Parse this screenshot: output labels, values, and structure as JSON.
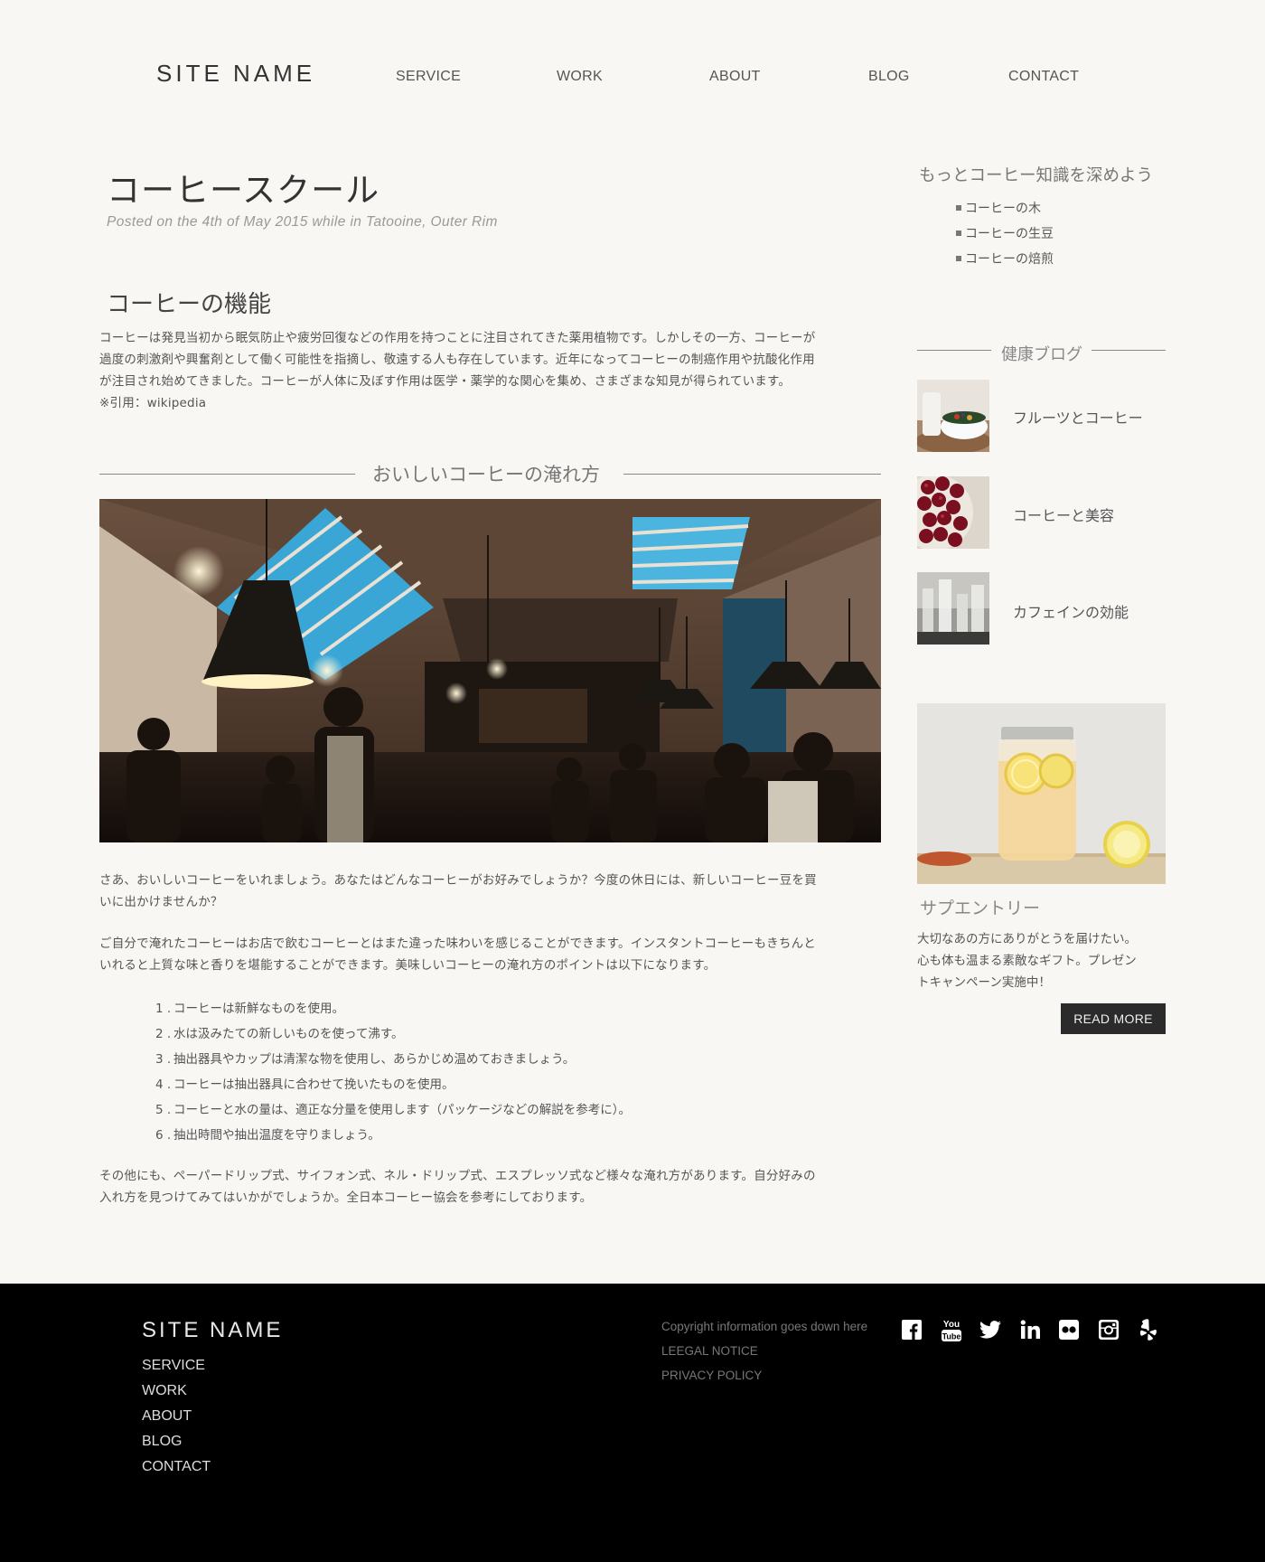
{
  "header": {
    "site_name": "SITE NAME",
    "nav": [
      "SERVICE",
      "WORK",
      "ABOUT",
      "BLOG",
      "CONTACT"
    ]
  },
  "article": {
    "title": "コーヒースクール",
    "posted": "Posted on the 4th of May 2015 while in Tatooine, Outer Rim",
    "section_title": "コーヒーの機能",
    "intro_lines": [
      "コーヒーは発見当初から眠気防止や疲労回復などの作用を持つことに注目されてきた薬用植物です。しかしその一方、コーヒーが",
      "過度の刺激剤や興奮剤として働く可能性を指摘し、敬遠する人も存在しています。近年になってコーヒーの制癌作用や抗酸化作用",
      "が注目され始めてきました。コーヒーが人体に及ぼす作用は医学・薬学的な関心を集め、さまざまな知見が得られています。",
      "※引用：wikipedia"
    ],
    "divider_title": "おいしいコーヒーの淹れ方",
    "para1_lines": [
      "さあ、おいしいコーヒーをいれましょう。あなたはどんなコーヒーがお好みでしょうか？今度の休日には、新しいコーヒー豆を買",
      "いに出かけませんか？"
    ],
    "para2_lines": [
      "ご自分で淹れたコーヒーはお店で飲むコーヒーとはまた違った味わいを感じることができます。インスタントコーヒーもきちんと",
      "いれると上質な味と香りを堪能することができます。美味しいコーヒーの淹れ方のポイントは以下になります。"
    ],
    "steps": [
      {
        "num": "1 .",
        "text": "コーヒーは新鮮なものを使用。"
      },
      {
        "num": "2 .",
        "text": "水は汲みたての新しいものを使って沸す。"
      },
      {
        "num": "3 .",
        "text": "抽出器具やカップは清潔な物を使用し、あらかじめ温めておきましょう。"
      },
      {
        "num": "4 .",
        "text": "コーヒーは抽出器具に合わせて挽いたものを使用。"
      },
      {
        "num": "5 .",
        "text": "コーヒーと水の量は、適正な分量を使用します（パッケージなどの解説を参考に）。"
      },
      {
        "num": "6 .",
        "text": "抽出時間や抽出温度を守りましょう。"
      }
    ],
    "para3_lines": [
      "その他にも、ペーパードリップ式、サイフォン式、ネル・ドリップ式、エスプレッソ式など様々な淹れ方があります。自分好みの",
      "入れ方を見つけてみてはいかがでしょうか。全日本コーヒー協会を参考にしております。"
    ]
  },
  "sidebar": {
    "heading": "もっとコーヒー知識を深めよう",
    "links": [
      "コーヒーの木",
      "コーヒーの生豆",
      "コーヒーの焙煎"
    ],
    "blog_heading": "健康ブログ",
    "blog_items": [
      "フルーツとコーヒー",
      "コーヒーと美容",
      "カフェインの効能"
    ],
    "promo_title": "サプエントリー",
    "promo_lines": [
      "大切なあの方にありがとうを届けたい。",
      "心も体も温まる素敵なギフト。プレゼン",
      "トキャンペーン実施中！"
    ],
    "read_more": "READ MORE"
  },
  "footer": {
    "site_name": "SITE NAME",
    "nav": [
      "SERVICE",
      "WORK",
      "ABOUT",
      "BLOG",
      "CONTACT"
    ],
    "copyright": "Copyright information goes down here",
    "legal": "LEEGAL NOTICE",
    "privacy": "PRIVACY POLICY",
    "social_icons": [
      "facebook-icon",
      "youtube-icon",
      "twitter-icon",
      "linkedin-icon",
      "flickr-icon",
      "instagram-icon",
      "yelp-icon"
    ],
    "youtube_text_top": "You",
    "youtube_text_bottom": "Tube"
  }
}
